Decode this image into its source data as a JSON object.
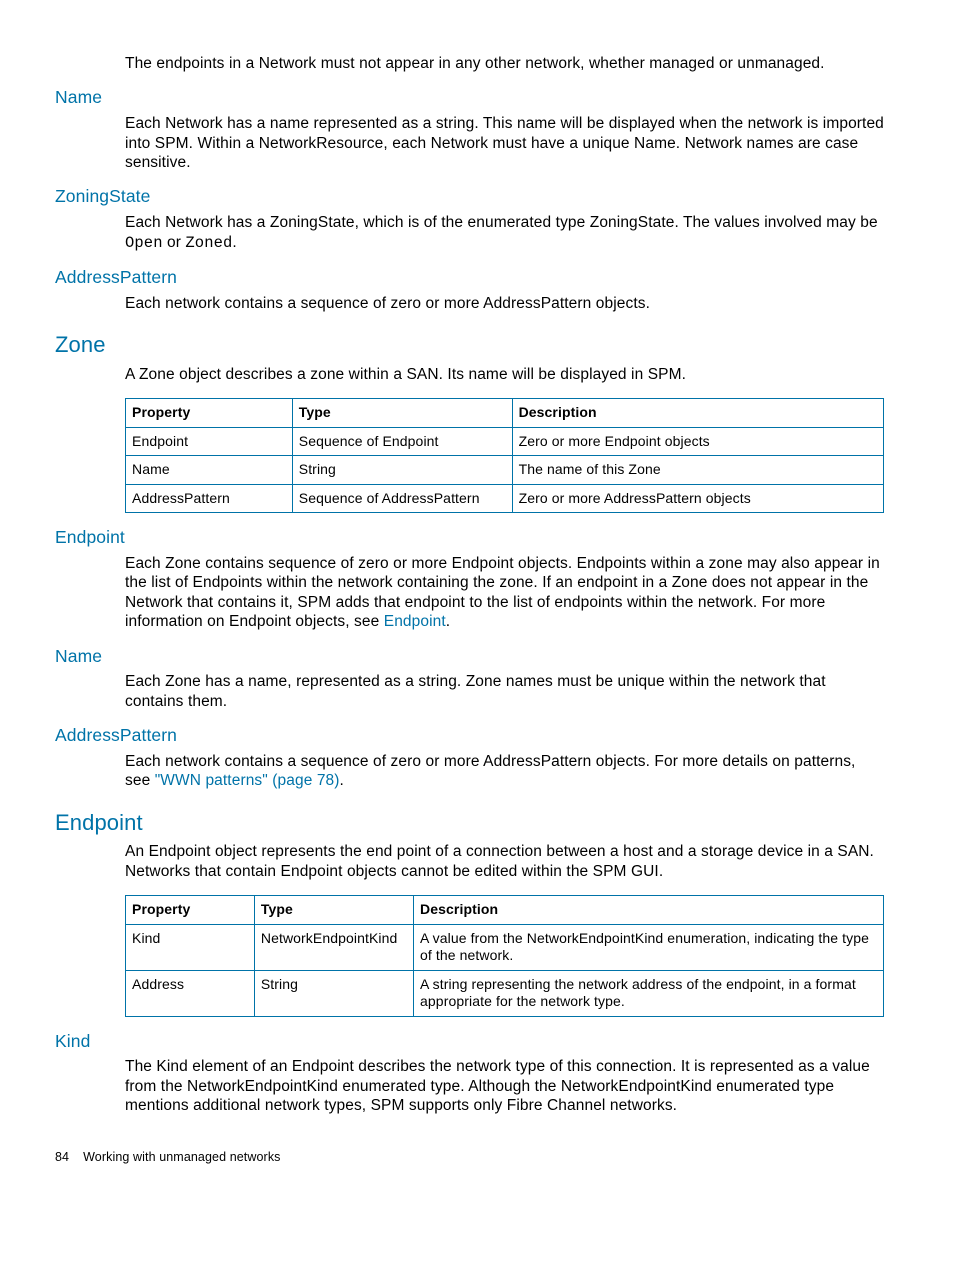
{
  "intro_paragraph": "The endpoints in a Network must not appear in any other network, whether managed or unmanaged.",
  "name1": {
    "heading": "Name",
    "body": "Each Network has a name represented as a string. This name will be displayed when the network is imported into SPM. Within a NetworkResource, each Network must have a unique Name. Network names are case sensitive."
  },
  "zoningstate": {
    "heading": "ZoningState",
    "body_pre": "Each Network has a ZoningState, which is of the enumerated type ZoningState. The values involved may be ",
    "code1": "Open",
    "body_mid": " or ",
    "code2": "Zoned",
    "body_post": "."
  },
  "addrpattern1": {
    "heading": "AddressPattern",
    "body": "Each network contains a sequence of zero or more AddressPattern objects."
  },
  "zone": {
    "heading": "Zone",
    "body": "A Zone object describes a zone within a SAN. Its name will be displayed in SPM.",
    "table": {
      "head": {
        "c1": "Property",
        "c2": "Type",
        "c3": "Description"
      },
      "rows": [
        {
          "c1": "Endpoint",
          "c2": "Sequence of Endpoint",
          "c3": "Zero or more Endpoint objects"
        },
        {
          "c1": "Name",
          "c2": "String",
          "c3": "The name of this Zone"
        },
        {
          "c1": "AddressPattern",
          "c2": "Sequence of AddressPattern",
          "c3": "Zero or more AddressPattern objects"
        }
      ]
    }
  },
  "endpoint1": {
    "heading": "Endpoint",
    "body_pre": "Each Zone contains sequence of zero or more Endpoint objects. Endpoints within a zone may also appear in the list of Endpoints within the network containing the zone. If an endpoint in a Zone does not appear in the Network that contains it, SPM adds that endpoint to the list of endpoints within the network. For more information on Endpoint objects, see ",
    "link": "Endpoint",
    "body_post": "."
  },
  "name2": {
    "heading": "Name",
    "body": "Each Zone has a name, represented as a string. Zone names must be unique within the network that contains them."
  },
  "addrpattern2": {
    "heading": "AddressPattern",
    "body_pre": "Each network contains a sequence of zero or more AddressPattern objects. For more details on patterns, see ",
    "link": "\"WWN patterns\" (page 78)",
    "body_post": "."
  },
  "endpoint2": {
    "heading": "Endpoint",
    "body": "An Endpoint object represents the end point of a connection between a host and a storage device in a SAN. Networks that contain Endpoint objects cannot be edited within the SPM GUI.",
    "table": {
      "head": {
        "c1": "Property",
        "c2": "Type",
        "c3": "Description"
      },
      "rows": [
        {
          "c1": "Kind",
          "c2": "NetworkEndpointKind",
          "c3": "A value from the NetworkEndpointKind enumeration, indicating the type of the network."
        },
        {
          "c1": "Address",
          "c2": "String",
          "c3": "A string representing the network address of the endpoint, in a format appropriate for the network type."
        }
      ]
    }
  },
  "kind": {
    "heading": "Kind",
    "body": "The Kind element of an Endpoint describes the network type of this connection. It is represented as a value from the NetworkEndpointKind enumerated type. Although the NetworkEndpointKind enumerated type mentions additional network types, SPM supports only Fibre Channel networks."
  },
  "footer": {
    "page": "84",
    "title": "Working with unmanaged networks"
  }
}
